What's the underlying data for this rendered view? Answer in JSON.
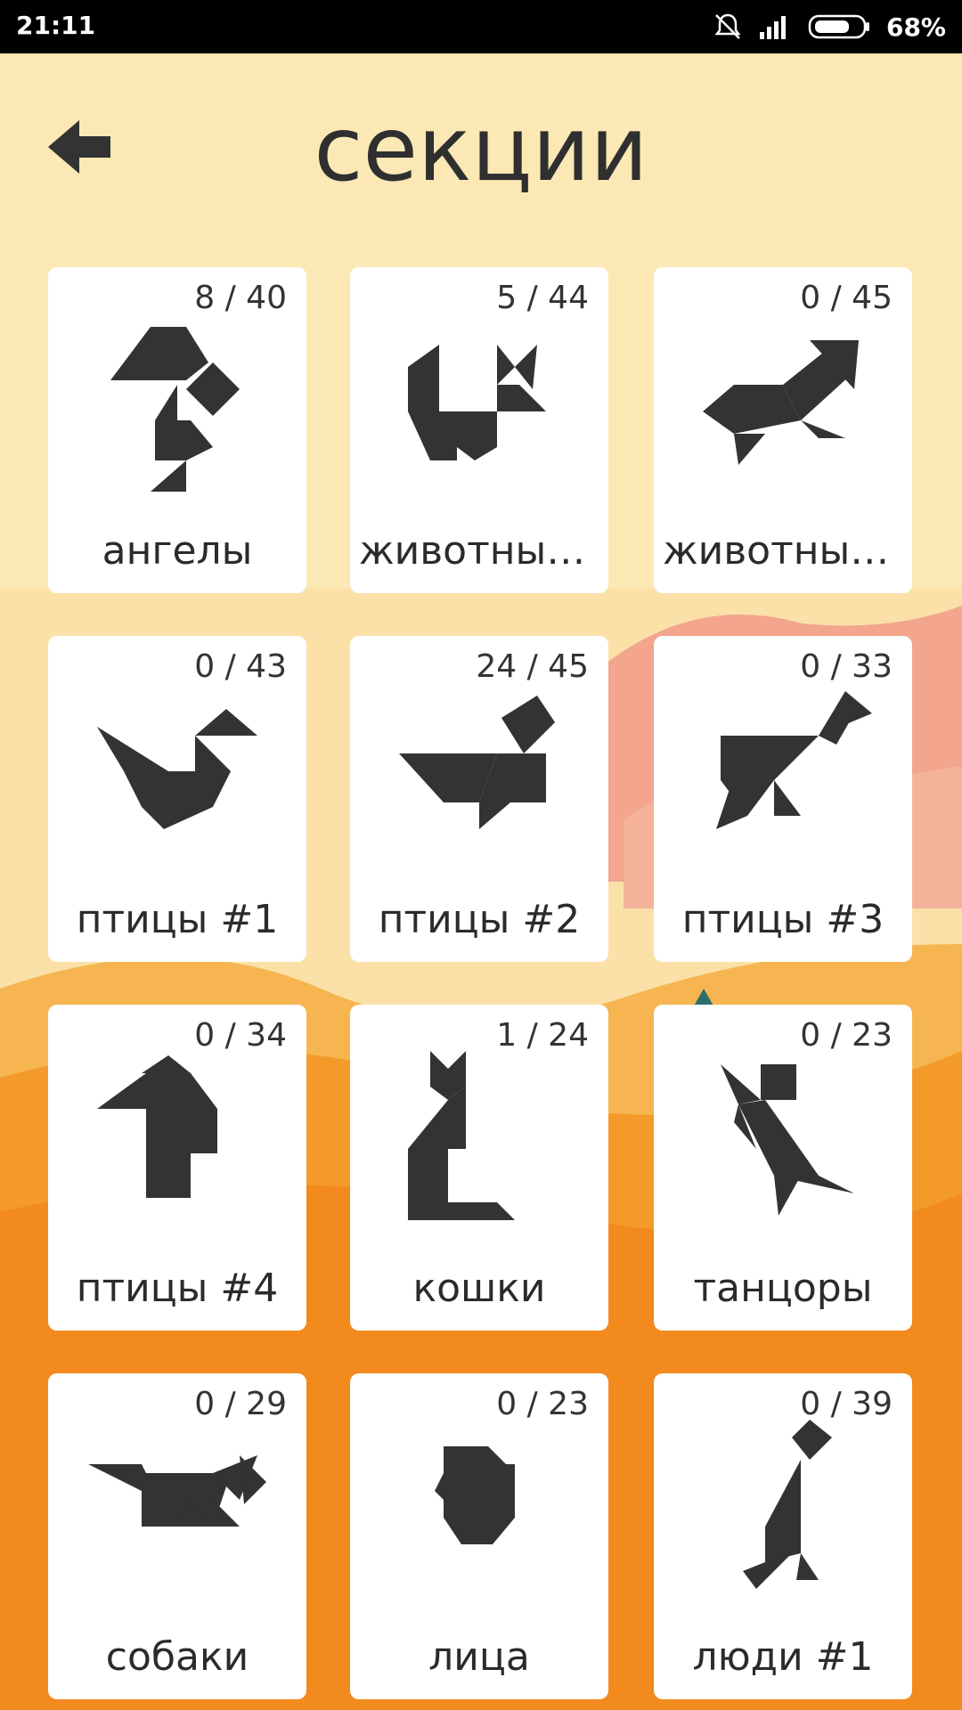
{
  "status_bar": {
    "time": "21:11",
    "battery": "68%",
    "icons": [
      "mute-icon",
      "signal-icon",
      "battery-icon"
    ]
  },
  "header": {
    "title": "секции",
    "back_icon": "back-arrow-icon"
  },
  "colors": {
    "accent": "#f48b1e",
    "figure": "#333333",
    "card": "#ffffff"
  },
  "sections": [
    {
      "label": "ангелы",
      "count": "8 / 40"
    },
    {
      "label": "животные...",
      "count": "5 / 44"
    },
    {
      "label": "животные...",
      "count": "0 / 45"
    },
    {
      "label": "птицы #1",
      "count": "0 / 43"
    },
    {
      "label": "птицы #2",
      "count": "24 / 45"
    },
    {
      "label": "птицы #3",
      "count": "0 / 33"
    },
    {
      "label": "птицы #4",
      "count": "0 / 34"
    },
    {
      "label": "кошки",
      "count": "1 / 24"
    },
    {
      "label": "танцоры",
      "count": "0 / 23"
    },
    {
      "label": "собаки",
      "count": "0 / 29"
    },
    {
      "label": "лица",
      "count": "0 / 23"
    },
    {
      "label": "люди #1",
      "count": "0 / 39"
    }
  ]
}
